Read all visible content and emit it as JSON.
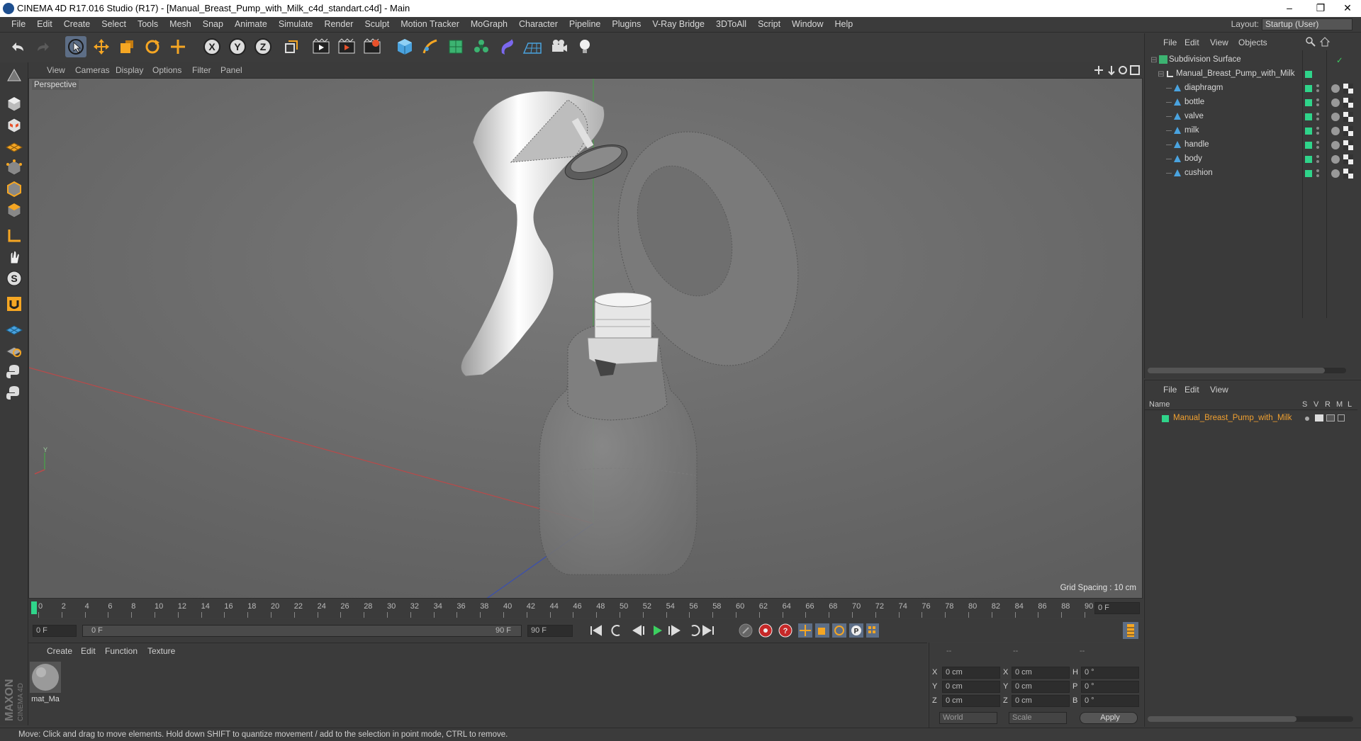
{
  "window": {
    "title": "CINEMA 4D R17.016 Studio (R17) - [Manual_Breast_Pump_with_Milk_c4d_standart.c4d] - Main",
    "controls": [
      "–",
      "❐",
      "✕"
    ]
  },
  "menubar": {
    "items": [
      "File",
      "Edit",
      "Create",
      "Select",
      "Tools",
      "Mesh",
      "Snap",
      "Animate",
      "Simulate",
      "Render",
      "Sculpt",
      "Motion Tracker",
      "MoGraph",
      "Character",
      "Pipeline",
      "Plugins",
      "V-Ray Bridge",
      "3DToAll",
      "Script",
      "Window",
      "Help"
    ],
    "layout_label": "Layout:",
    "layout_value": "Startup (User)"
  },
  "toolbar": {
    "icons": [
      "undo-icon",
      "redo-icon",
      "select-arrow-icon",
      "move-icon",
      "scale-icon",
      "rotate-icon",
      "transform-icon",
      "axis-x-icon",
      "axis-y-icon",
      "axis-z-icon",
      "coordinate-system-icon",
      "render-view-icon",
      "render-picture-viewer-icon",
      "render-settings-icon",
      "cube-icon",
      "pen-icon",
      "subdivision-icon",
      "cloner-icon",
      "deformer-icon",
      "floor-icon",
      "camera-icon",
      "light-icon"
    ],
    "axis_labels": [
      "X",
      "Y",
      "Z"
    ]
  },
  "viewport_menu": {
    "items": [
      "View",
      "Cameras",
      "Display",
      "Options",
      "Filter",
      "Panel"
    ]
  },
  "viewport": {
    "label": "Perspective",
    "grid_spacing": "Grid Spacing : 10 cm"
  },
  "timeline": {
    "ticks": [
      "0",
      "2",
      "4",
      "6",
      "8",
      "10",
      "12",
      "14",
      "16",
      "18",
      "20",
      "22",
      "24",
      "26",
      "28",
      "30",
      "32",
      "34",
      "36",
      "38",
      "40",
      "42",
      "44",
      "46",
      "48",
      "50",
      "52",
      "54",
      "56",
      "58",
      "60",
      "62",
      "64",
      "66",
      "68",
      "70",
      "72",
      "74",
      "76",
      "78",
      "80",
      "82",
      "84",
      "86",
      "88",
      "90"
    ],
    "current_frame": "0 F",
    "start_field": "0 F",
    "range_start": "0 F",
    "range_end": "90 F",
    "end_field": "90 F"
  },
  "materials": {
    "menu": [
      "Create",
      "Edit",
      "Function",
      "Texture"
    ],
    "items": [
      {
        "name": "mat_Ma"
      }
    ]
  },
  "coordinates": {
    "header": [
      "--",
      "--",
      "--"
    ],
    "rows": [
      {
        "a": "X",
        "av": "0 cm",
        "b": "X",
        "bv": "0 cm",
        "c": "H",
        "cv": "0 °"
      },
      {
        "a": "Y",
        "av": "0 cm",
        "b": "Y",
        "bv": "0 cm",
        "c": "P",
        "cv": "0 °"
      },
      {
        "a": "Z",
        "av": "0 cm",
        "b": "Z",
        "bv": "0 cm",
        "c": "B",
        "cv": "0 °"
      }
    ],
    "world": "World",
    "scale": "Scale",
    "apply": "Apply"
  },
  "objects": {
    "menu": [
      "File",
      "Edit",
      "View",
      "Objects"
    ],
    "tree": [
      {
        "name": "Subdivision Surface",
        "level": 0
      },
      {
        "name": "Manual_Breast_Pump_with_Milk",
        "level": 1
      },
      {
        "name": "diaphragm",
        "level": 2
      },
      {
        "name": "bottle",
        "level": 2
      },
      {
        "name": "valve",
        "level": 2
      },
      {
        "name": "milk",
        "level": 2
      },
      {
        "name": "handle",
        "level": 2
      },
      {
        "name": "body",
        "level": 2
      },
      {
        "name": "cushion",
        "level": 2
      }
    ]
  },
  "attributes": {
    "menu": [
      "File",
      "Edit",
      "View"
    ],
    "columns": [
      "Name",
      "S",
      "V",
      "R",
      "M",
      "L"
    ],
    "row": "Manual_Breast_Pump_with_Milk"
  },
  "status": "Move: Click and drag to move elements. Hold down SHIFT to quantize movement / add to the selection in point mode, CTRL to remove.",
  "colors": {
    "accent": "#2fd48a",
    "selection": "#f0a030",
    "active_tool": "#5d6e86"
  }
}
